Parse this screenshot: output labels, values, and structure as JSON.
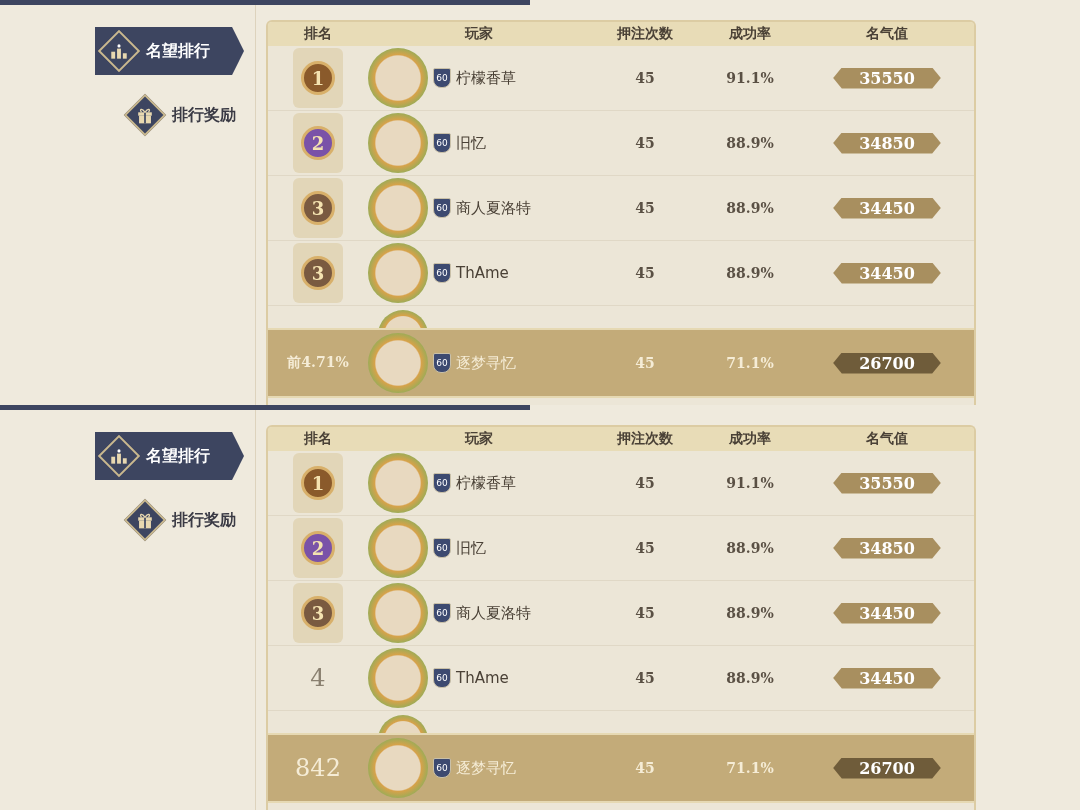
{
  "panels": [
    {
      "nav": [
        {
          "label": "名望排行",
          "kind": "podium",
          "selected": true
        },
        {
          "label": "排行奖励",
          "kind": "gift",
          "selected": false
        }
      ],
      "table": {
        "columns": [
          "排名",
          "玩家",
          "押注次数",
          "成功率",
          "名气值"
        ],
        "rows": [
          {
            "rank": "1",
            "kind": "medal",
            "color": "#8a5a2b",
            "level_badge": "60",
            "player": "柠檬香草",
            "bets": "45",
            "rate": "91.1%",
            "score": "35550"
          },
          {
            "rank": "2",
            "kind": "medal",
            "color": "#7a52a8",
            "level_badge": "60",
            "player": "旧忆",
            "bets": "45",
            "rate": "88.9%",
            "score": "34850"
          },
          {
            "rank": "3",
            "kind": "medal",
            "color": "#7a5a40",
            "level_badge": "60",
            "player": "商人夏洛特",
            "bets": "45",
            "rate": "88.9%",
            "score": "34450"
          },
          {
            "rank": "3",
            "kind": "medal",
            "color": "#7a5a40",
            "level_badge": "60",
            "player": "ThAme",
            "bets": "45",
            "rate": "88.9%",
            "score": "34450"
          }
        ],
        "own_row": {
          "rank": "前4.71%",
          "level_badge": "60",
          "player": "逐梦寻忆",
          "bets": "45",
          "rate": "71.1%",
          "score": "26700"
        }
      }
    },
    {
      "nav": [
        {
          "label": "名望排行",
          "kind": "podium",
          "selected": true
        },
        {
          "label": "排行奖励",
          "kind": "gift",
          "selected": false
        }
      ],
      "table": {
        "columns": [
          "排名",
          "玩家",
          "押注次数",
          "成功率",
          "名气值"
        ],
        "rows": [
          {
            "rank": "1",
            "kind": "medal",
            "color": "#8a5a2b",
            "level_badge": "60",
            "player": "柠檬香草",
            "bets": "45",
            "rate": "91.1%",
            "score": "35550"
          },
          {
            "rank": "2",
            "kind": "medal",
            "color": "#7a52a8",
            "level_badge": "60",
            "player": "旧忆",
            "bets": "45",
            "rate": "88.9%",
            "score": "34850"
          },
          {
            "rank": "3",
            "kind": "medal",
            "color": "#7a5a40",
            "level_badge": "60",
            "player": "商人夏洛特",
            "bets": "45",
            "rate": "88.9%",
            "score": "34450"
          },
          {
            "rank": "4",
            "kind": "plain",
            "level_badge": "60",
            "player": "ThAme",
            "bets": "45",
            "rate": "88.9%",
            "score": "34450"
          }
        ],
        "own_row": {
          "rank": "842",
          "level_badge": "60",
          "player": "逐梦寻忆",
          "bets": "45",
          "rate": "71.1%",
          "score": "26700"
        }
      }
    }
  ]
}
